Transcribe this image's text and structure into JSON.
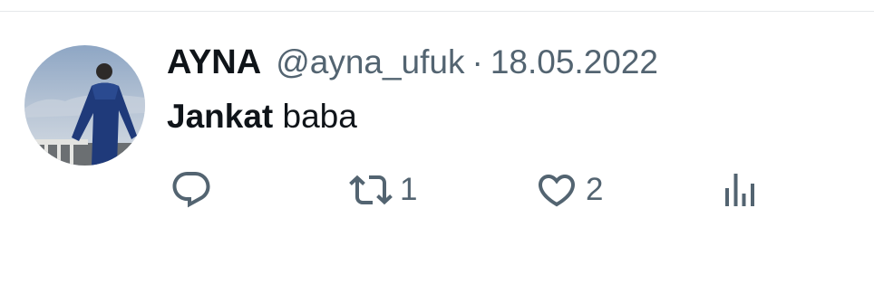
{
  "tweet": {
    "display_name": "AYNA",
    "handle": "@ayna_ufuk",
    "separator": "·",
    "date": "18.05.2022",
    "text_bold": "Jankat",
    "text_rest": " baba"
  },
  "actions": {
    "reply": {
      "icon": "reply-icon",
      "count": ""
    },
    "retweet": {
      "icon": "retweet-icon",
      "count": "1"
    },
    "like": {
      "icon": "heart-icon",
      "count": "2"
    },
    "views": {
      "icon": "views-icon",
      "count": ""
    }
  },
  "colors": {
    "text_primary": "#0f1419",
    "text_secondary": "#536471",
    "divider": "#e6e8ea"
  }
}
